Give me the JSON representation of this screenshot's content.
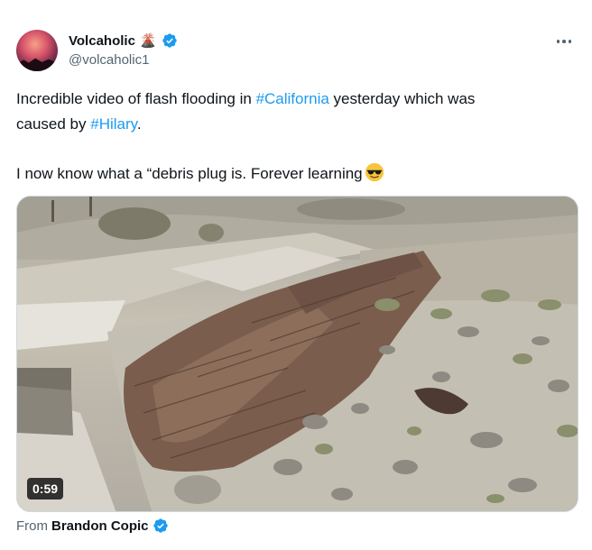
{
  "author": {
    "display_name": "Volcaholic",
    "name_emoji": "volcano-emoji",
    "handle": "@volcaholic1",
    "verified": true
  },
  "tweet": {
    "line1_before": "Incredible video of flash flooding in ",
    "hashtag1": "#California",
    "line1_after": " yesterday which was",
    "line2_before": "caused by ",
    "hashtag2": "#Hilary",
    "line2_after": ".",
    "line3": "I now know what a “debris plug is. Forever learning",
    "line3_emoji": "smiling-face-with-sunglasses-emoji"
  },
  "media": {
    "duration": "0:59",
    "description_icon": "video-player"
  },
  "attribution": {
    "prefix": "From",
    "name": "Brandon Copic",
    "verified": true
  },
  "colors": {
    "link": "#1d9bf0",
    "text": "#0f1419",
    "secondary": "#536471",
    "verified": "#1d9bf0"
  }
}
